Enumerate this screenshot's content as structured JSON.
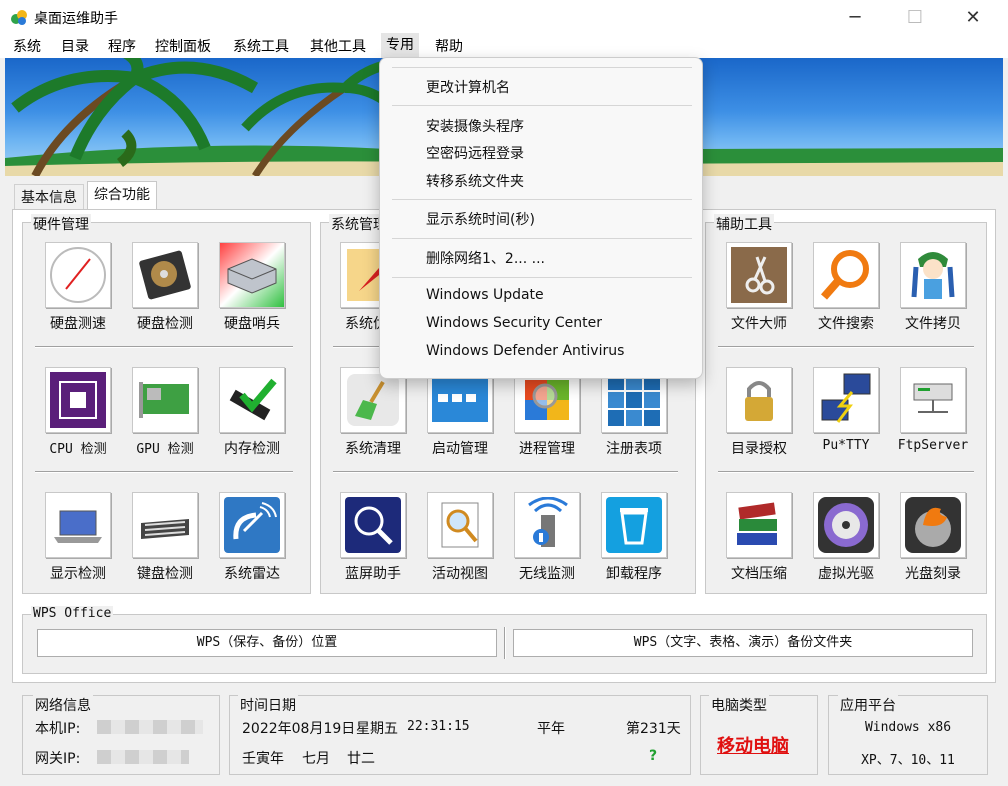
{
  "window": {
    "title": "桌面运维助手",
    "controls": {
      "minimize": "─",
      "maximize": "☐",
      "close": "✕"
    }
  },
  "menu": [
    "系统",
    "目录",
    "程序",
    "控制面板",
    "系统工具",
    "其他工具",
    "专用",
    "帮助"
  ],
  "tabs": [
    "基本信息",
    "综合功能"
  ],
  "groups": {
    "hardware": "硬件管理",
    "system": "系统管理",
    "tools": "辅助工具",
    "wps": "WPS Office"
  },
  "hardware_items": [
    "硬盘测速",
    "硬盘检测",
    "硬盘哨兵",
    "CPU 检测",
    "GPU 检测",
    "内存检测",
    "显示检测",
    "键盘检测",
    "系统雷达"
  ],
  "system_items": [
    "系统优化",
    "",
    "",
    "",
    "系统清理",
    "启动管理",
    "进程管理",
    "注册表项",
    "蓝屏助手",
    "活动视图",
    "无线监测",
    "卸载程序"
  ],
  "tools_items": [
    "文件大师",
    "文件搜索",
    "文件拷贝",
    "目录授权",
    "Pu*TTY",
    "FtpServer",
    "文档压缩",
    "虚拟光驱",
    "光盘刻录"
  ],
  "wps": {
    "btn1": "WPS（保存、备份）位置",
    "btn2": "WPS（文字、表格、演示）备份文件夹"
  },
  "network": {
    "title": "网络信息",
    "ip_label": "本机IP:",
    "gw_label": "网关IP:"
  },
  "datetime": {
    "title": "时间日期",
    "date": "2022年08月19日",
    "weekday": "星期五",
    "time": "22:31:15",
    "year_type": "平年",
    "day_of_year": "第231天",
    "lunar_year": "壬寅年",
    "lunar_month": "七月",
    "lunar_day": "廿二",
    "help": "?"
  },
  "pc_type": {
    "title": "电脑类型",
    "value": "移动电脑",
    "color": "#e01010"
  },
  "platform": {
    "title": "应用平台",
    "line1": "Windows x86",
    "line2": "XP、7、10、11"
  },
  "dropdown": [
    "更改计算机名",
    "安装摄像头程序",
    "空密码远程登录",
    "转移系统文件夹",
    "显示系统时间(秒)",
    "删除网络1、2... ...",
    "Windows Update",
    "Windows Security Center",
    "Windows Defender Antivirus"
  ]
}
